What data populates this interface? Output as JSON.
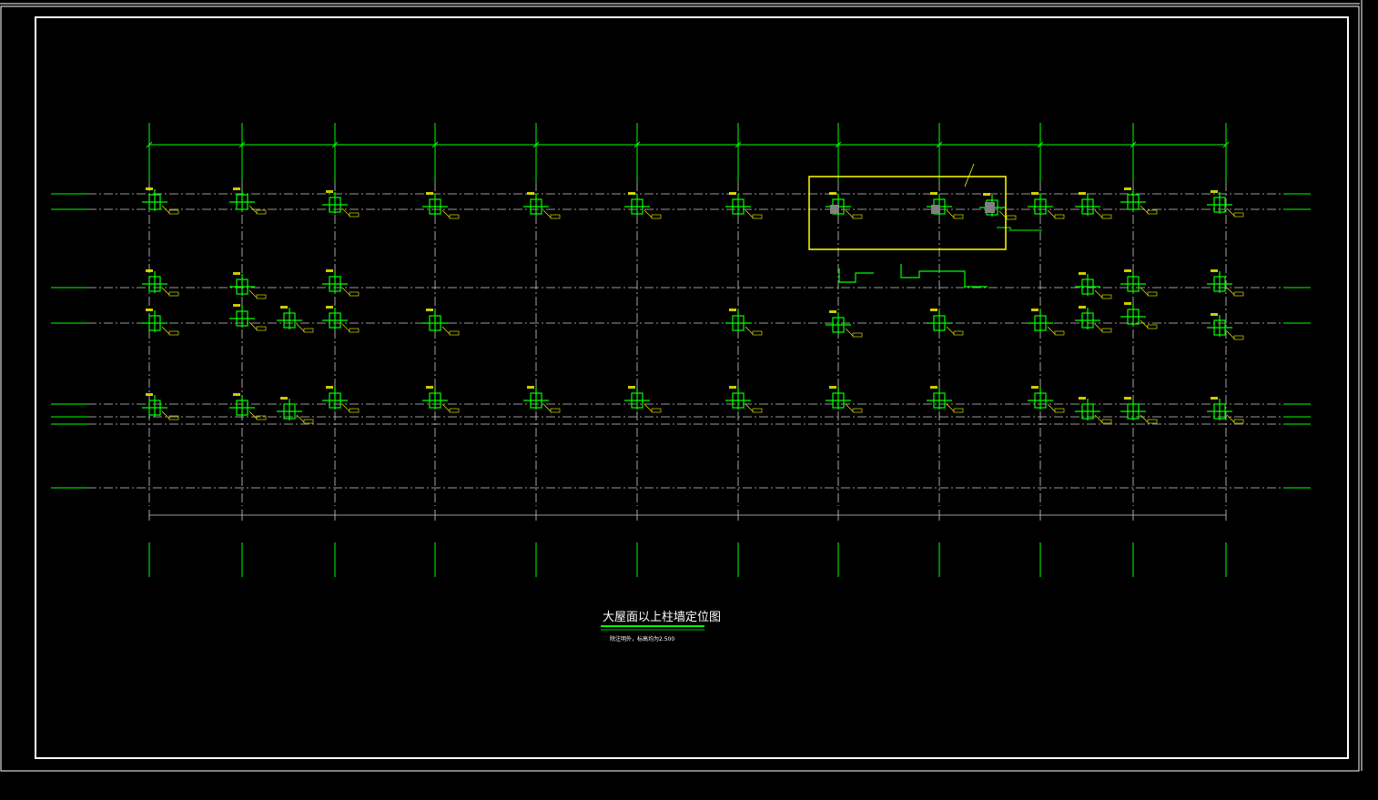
{
  "drawing": {
    "title": "大屋面以上柱墙定位图",
    "note": "除注明外，标高均为",
    "elevation": "2.500",
    "colors": {
      "background": "#000000",
      "frame": "#ffffff",
      "axis_line": "#00ff00",
      "grid_line": "#cccccc",
      "annotation": "#ffff00",
      "wall_fill": "#808080"
    },
    "highlight_box": {
      "color": "#ffff00"
    }
  }
}
